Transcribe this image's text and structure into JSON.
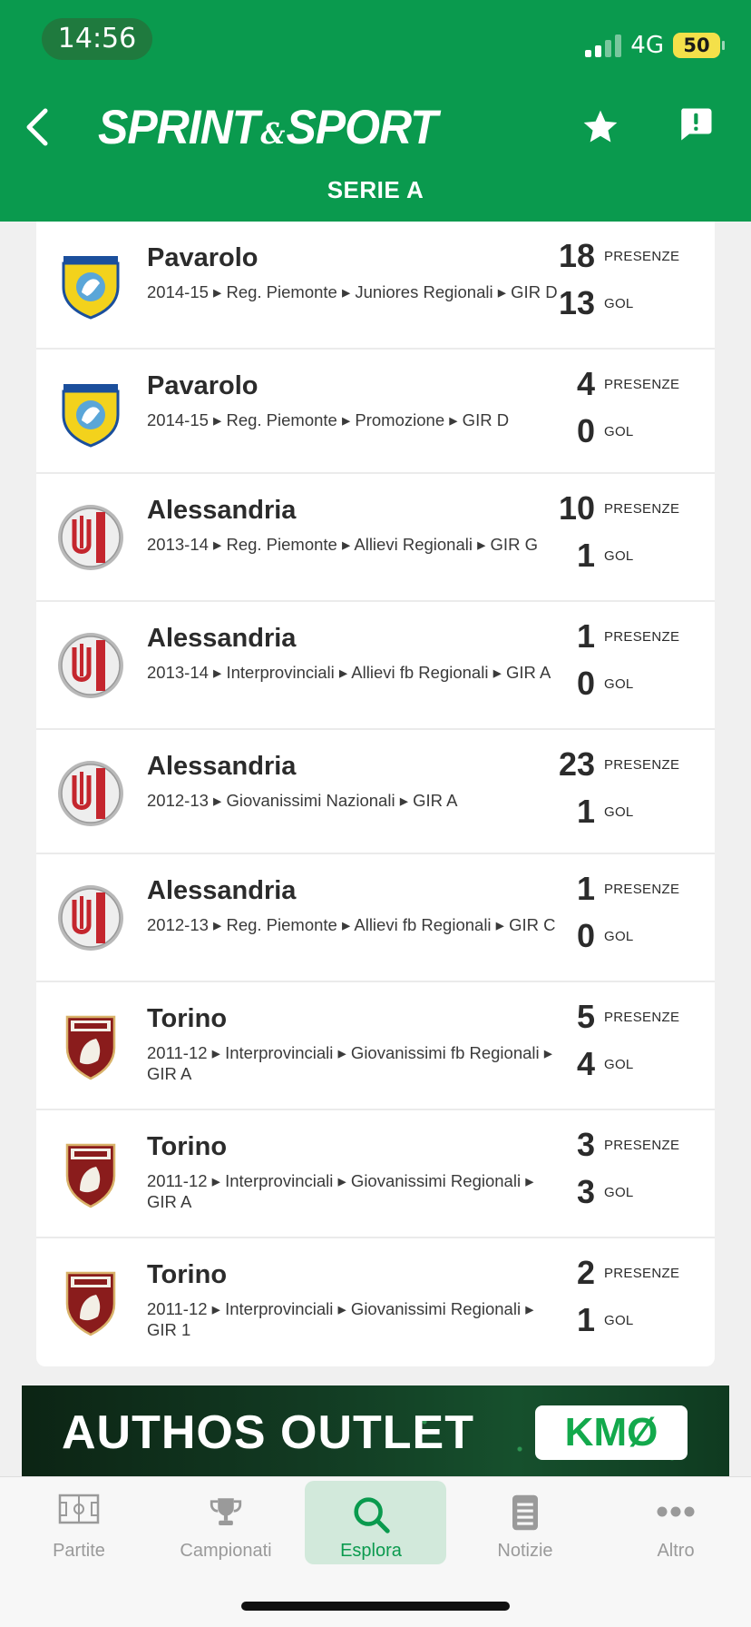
{
  "status_bar": {
    "time": "14:56",
    "network": "4G",
    "battery": "50"
  },
  "header": {
    "logo_left": "SPRINT",
    "logo_amp": "&",
    "logo_right": "SPORT",
    "subtitle": "SERIE A"
  },
  "career": [
    {
      "club": "Pavarolo",
      "logo": "pavarolo",
      "path": "2014-15 ▸ Reg. Piemonte ▸ Juniores Regionali ▸ GIR D",
      "presenze": "18",
      "gol": "13"
    },
    {
      "club": "Pavarolo",
      "logo": "pavarolo",
      "path": "2014-15 ▸ Reg. Piemonte ▸ Promozione ▸ GIR D",
      "presenze": "4",
      "gol": "0"
    },
    {
      "club": "Alessandria",
      "logo": "alessandria",
      "path": "2013-14 ▸ Reg. Piemonte ▸ Allievi Regionali ▸ GIR G",
      "presenze": "10",
      "gol": "1"
    },
    {
      "club": "Alessandria",
      "logo": "alessandria",
      "path": "2013-14 ▸ Interprovinciali ▸ Allievi fb Regionali ▸ GIR A",
      "presenze": "1",
      "gol": "0"
    },
    {
      "club": "Alessandria",
      "logo": "alessandria",
      "path": "2012-13 ▸ Giovanissimi Nazionali ▸ GIR A",
      "presenze": "23",
      "gol": "1"
    },
    {
      "club": "Alessandria",
      "logo": "alessandria",
      "path": "2012-13 ▸ Reg. Piemonte ▸ Allievi fb Regionali ▸ GIR C",
      "presenze": "1",
      "gol": "0"
    },
    {
      "club": "Torino",
      "logo": "torino",
      "path": "2011-12 ▸ Interprovinciali ▸ Giovanissimi fb Regionali ▸ GIR A",
      "presenze": "5",
      "gol": "4"
    },
    {
      "club": "Torino",
      "logo": "torino",
      "path": "2011-12 ▸ Interprovinciali ▸ Giovanissimi Regionali ▸ GIR A",
      "presenze": "3",
      "gol": "3"
    },
    {
      "club": "Torino",
      "logo": "torino",
      "path": "2011-12 ▸ Interprovinciali ▸ Giovanissimi Regionali ▸ GIR 1",
      "presenze": "2",
      "gol": "1"
    }
  ],
  "stat_labels": {
    "presenze": "PRESENZE",
    "gol": "GOL"
  },
  "banner": {
    "text": "AUTHOS OUTLET",
    "brand": "KMØ"
  },
  "tabs": [
    {
      "label": "Partite",
      "icon": "pitch-icon"
    },
    {
      "label": "Campionati",
      "icon": "trophy-icon"
    },
    {
      "label": "Esplora",
      "icon": "search-icon",
      "active": true
    },
    {
      "label": "Notizie",
      "icon": "news-icon"
    },
    {
      "label": "Altro",
      "icon": "more-icon"
    }
  ],
  "colors": {
    "brand_green": "#0a9a4e",
    "active_tab_bg": "#d2e9db"
  }
}
